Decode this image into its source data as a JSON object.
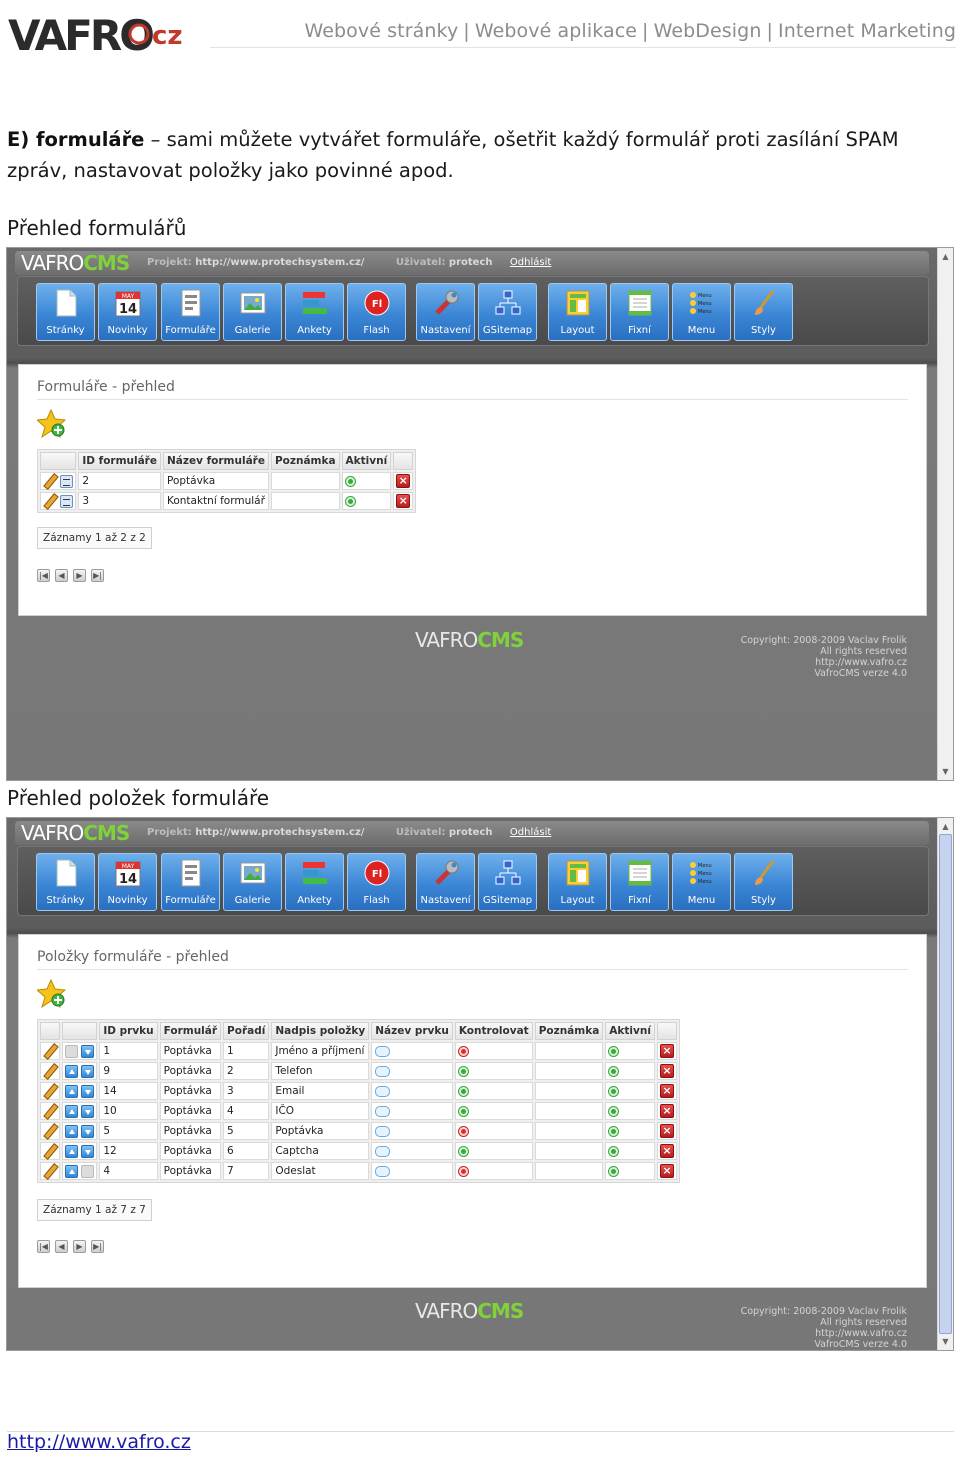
{
  "brand": {
    "logo_text": "VAFRO",
    "logo_suffix": "cz"
  },
  "topnav": {
    "items": [
      "Webové stránky",
      "Webové aplikace",
      "WebDesign",
      "Internet Marketing"
    ],
    "separator": "|"
  },
  "intro": {
    "lead": "E) formuláře",
    "dash": "–",
    "text": "sami můžete vytvářet formuláře, ošetřit každý formulář proti zasílání SPAM zpráv, nastavovat položky jako povinné apod."
  },
  "section1_title": "Přehled formulářů",
  "section2_title": "Přehled položek formuláře",
  "cms": {
    "logo_main": "VAFRO",
    "logo_cms": "CMS",
    "project_label": "Projekt:",
    "project_value": "http://www.protechsystem.cz/",
    "user_label": "Uživatel:",
    "user_value": "protech",
    "logout": "Odhlásit",
    "toolbar": [
      {
        "label": "Stránky",
        "icon": "page-icon"
      },
      {
        "label": "Novinky",
        "icon": "calendar-icon"
      },
      {
        "label": "Formuláře",
        "icon": "form-icon"
      },
      {
        "label": "Galerie",
        "icon": "gallery-icon"
      },
      {
        "label": "Ankety",
        "icon": "poll-icon"
      },
      {
        "label": "Flash",
        "icon": "flash-icon"
      },
      {
        "label": "Nastavení",
        "icon": "wrench-icon"
      },
      {
        "label": "GSitemap",
        "icon": "sitemap-icon"
      },
      {
        "label": "Layout",
        "icon": "layout-icon"
      },
      {
        "label": "Fixní",
        "icon": "fixed-icon"
      },
      {
        "label": "Menu",
        "icon": "menu-icon"
      },
      {
        "label": "Styly",
        "icon": "brush-icon"
      }
    ],
    "calendar_month": "MAY",
    "calendar_day": "14",
    "flash_glyph": "Fl",
    "menu_glyph": "Menu",
    "copyright_lines": [
      "Copyright: 2008-2009 Vaclav Frolik",
      "All rights reserved",
      "http://www.vafro.cz",
      "VafroCMS verze 4.0"
    ]
  },
  "forms_overview": {
    "title": "Formuláře - přehled",
    "columns": [
      "ID formuláře",
      "Název formuláře",
      "Poznámka",
      "Aktivní"
    ],
    "rows": [
      {
        "id": "2",
        "name": "Poptávka",
        "note": "",
        "active": true
      },
      {
        "id": "3",
        "name": "Kontaktní formulář",
        "note": "",
        "active": true
      }
    ],
    "records": "Záznamy 1 až 2 z 2"
  },
  "items_overview": {
    "title": "Položky formuláře - přehled",
    "columns": [
      "ID prvku",
      "Formulář",
      "Pořadí",
      "Nadpis položky",
      "Název prvku",
      "Kontrolovat",
      "Poznámka",
      "Aktivní"
    ],
    "rows": [
      {
        "id": "1",
        "form": "Poptávka",
        "order": "1",
        "heading": "Jméno a příjmení",
        "validate": false,
        "active": true
      },
      {
        "id": "9",
        "form": "Poptávka",
        "order": "2",
        "heading": "Telefon",
        "validate": true,
        "active": true
      },
      {
        "id": "14",
        "form": "Poptávka",
        "order": "3",
        "heading": "Email",
        "validate": true,
        "active": true
      },
      {
        "id": "10",
        "form": "Poptávka",
        "order": "4",
        "heading": "IČO",
        "validate": true,
        "active": true
      },
      {
        "id": "5",
        "form": "Poptávka",
        "order": "5",
        "heading": "Poptávka",
        "validate": false,
        "active": true
      },
      {
        "id": "12",
        "form": "Poptávka",
        "order": "6",
        "heading": "Captcha",
        "validate": true,
        "active": true
      },
      {
        "id": "4",
        "form": "Poptávka",
        "order": "7",
        "heading": "Odeslat",
        "validate": false,
        "active": true
      }
    ],
    "records": "Záznamy 1 až 7 z 7"
  },
  "pager_glyphs": [
    "|◀",
    "◀",
    "▶",
    "▶|"
  ],
  "footer_link": "http://www.vafro.cz",
  "colors": {
    "toolbar_blue": "#3b86d5",
    "cms_green": "#7fd23a",
    "panel_gray": "#707070"
  }
}
